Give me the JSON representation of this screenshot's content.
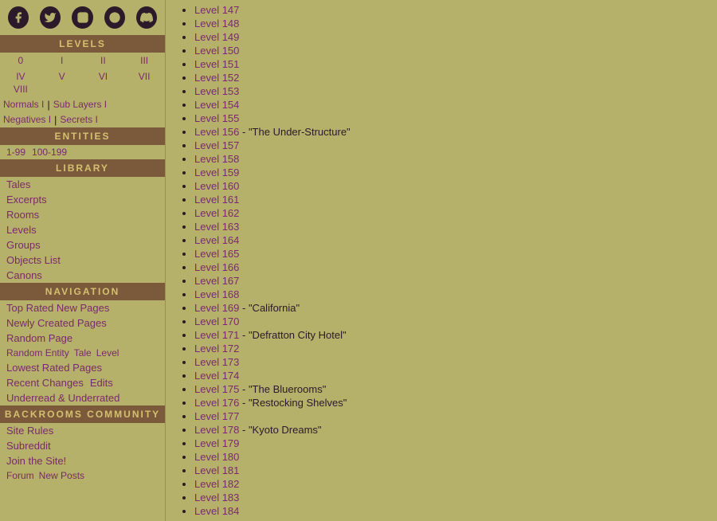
{
  "social": {
    "icons": [
      {
        "name": "facebook",
        "symbol": "f"
      },
      {
        "name": "twitter",
        "symbol": "t"
      },
      {
        "name": "instagram",
        "symbol": "i"
      },
      {
        "name": "reddit",
        "symbol": "r"
      },
      {
        "name": "discord",
        "symbol": "d"
      }
    ]
  },
  "sections": {
    "levels_header": "LEVELS",
    "entities_header": "ENTITIES",
    "library_header": "LIBRARY",
    "navigation_header": "NAVIGATION",
    "community_header": "BACKROOMS COMMUNITY"
  },
  "levels": {
    "numbers": [
      "0",
      "I",
      "II",
      "III",
      "IV",
      "V",
      "VI",
      "VII",
      "VIII"
    ],
    "normals": [
      "Normals I"
    ],
    "sublayers": [
      "Sub Layers I"
    ],
    "negatives": [
      "Negatives I"
    ],
    "secrets": [
      "Secrets I"
    ]
  },
  "entities": {
    "range1": "1-99",
    "range2": "100-199"
  },
  "library": {
    "items": [
      "Tales",
      "Excerpts",
      "Rooms",
      "Levels",
      "Groups",
      "Objects List",
      "Canons"
    ]
  },
  "navigation": {
    "items": [
      "Top Rated New Pages",
      "Newly Created Pages",
      "Random Page"
    ],
    "inline": [
      "Random Entity",
      "Tale",
      "Level"
    ],
    "bottom": [
      "Lowest Rated Pages"
    ],
    "recent": [
      "Recent Changes",
      "Edits"
    ],
    "underrated": "Underread & Underrated"
  },
  "community": {
    "items": [
      "Site Rules",
      "Subreddit",
      "Join the Site!"
    ],
    "bottom": [
      "Forum",
      "New Posts"
    ]
  },
  "main_list": [
    {
      "id": "level-147",
      "text": "Level 147",
      "subtitle": ""
    },
    {
      "id": "level-148",
      "text": "Level 148",
      "subtitle": ""
    },
    {
      "id": "level-149",
      "text": "Level 149",
      "subtitle": ""
    },
    {
      "id": "level-150",
      "text": "Level 150",
      "subtitle": ""
    },
    {
      "id": "level-151",
      "text": "Level 151",
      "subtitle": ""
    },
    {
      "id": "level-152",
      "text": "Level 152",
      "subtitle": ""
    },
    {
      "id": "level-153",
      "text": "Level 153",
      "subtitle": ""
    },
    {
      "id": "level-154",
      "text": "Level 154",
      "subtitle": ""
    },
    {
      "id": "level-155",
      "text": "Level 155",
      "subtitle": ""
    },
    {
      "id": "level-156",
      "text": "Level 156",
      "subtitle": " - \"The Under-Structure\""
    },
    {
      "id": "level-157",
      "text": "Level 157",
      "subtitle": ""
    },
    {
      "id": "level-158",
      "text": "Level 158",
      "subtitle": ""
    },
    {
      "id": "level-159",
      "text": "Level 159",
      "subtitle": ""
    },
    {
      "id": "level-160",
      "text": "Level 160",
      "subtitle": ""
    },
    {
      "id": "level-161",
      "text": "Level 161",
      "subtitle": ""
    },
    {
      "id": "level-162",
      "text": "Level 162",
      "subtitle": ""
    },
    {
      "id": "level-163",
      "text": "Level 163",
      "subtitle": ""
    },
    {
      "id": "level-164",
      "text": "Level 164",
      "subtitle": ""
    },
    {
      "id": "level-165",
      "text": "Level 165",
      "subtitle": ""
    },
    {
      "id": "level-166",
      "text": "Level 166",
      "subtitle": ""
    },
    {
      "id": "level-167",
      "text": "Level 167",
      "subtitle": ""
    },
    {
      "id": "level-168",
      "text": "Level 168",
      "subtitle": ""
    },
    {
      "id": "level-169",
      "text": "Level 169",
      "subtitle": " - \"California\""
    },
    {
      "id": "level-170",
      "text": "Level 170",
      "subtitle": ""
    },
    {
      "id": "level-171",
      "text": "Level 171",
      "subtitle": " - \"Defratton City Hotel\""
    },
    {
      "id": "level-172",
      "text": "Level 172",
      "subtitle": ""
    },
    {
      "id": "level-173",
      "text": "Level 173",
      "subtitle": ""
    },
    {
      "id": "level-174",
      "text": "Level 174",
      "subtitle": ""
    },
    {
      "id": "level-175",
      "text": "Level 175",
      "subtitle": " - \"The Bluerooms\""
    },
    {
      "id": "level-176",
      "text": "Level 176",
      "subtitle": " - \"Restocking Shelves\""
    },
    {
      "id": "level-177",
      "text": "Level 177",
      "subtitle": ""
    },
    {
      "id": "level-178",
      "text": "Level 178",
      "subtitle": " - \"Kyoto Dreams\""
    },
    {
      "id": "level-179",
      "text": "Level 179",
      "subtitle": ""
    },
    {
      "id": "level-180",
      "text": "Level 180",
      "subtitle": ""
    },
    {
      "id": "level-181",
      "text": "Level 181",
      "subtitle": ""
    },
    {
      "id": "level-182",
      "text": "Level 182",
      "subtitle": ""
    },
    {
      "id": "level-183",
      "text": "Level 183",
      "subtitle": ""
    },
    {
      "id": "level-184",
      "text": "Level 184",
      "subtitle": ""
    }
  ]
}
